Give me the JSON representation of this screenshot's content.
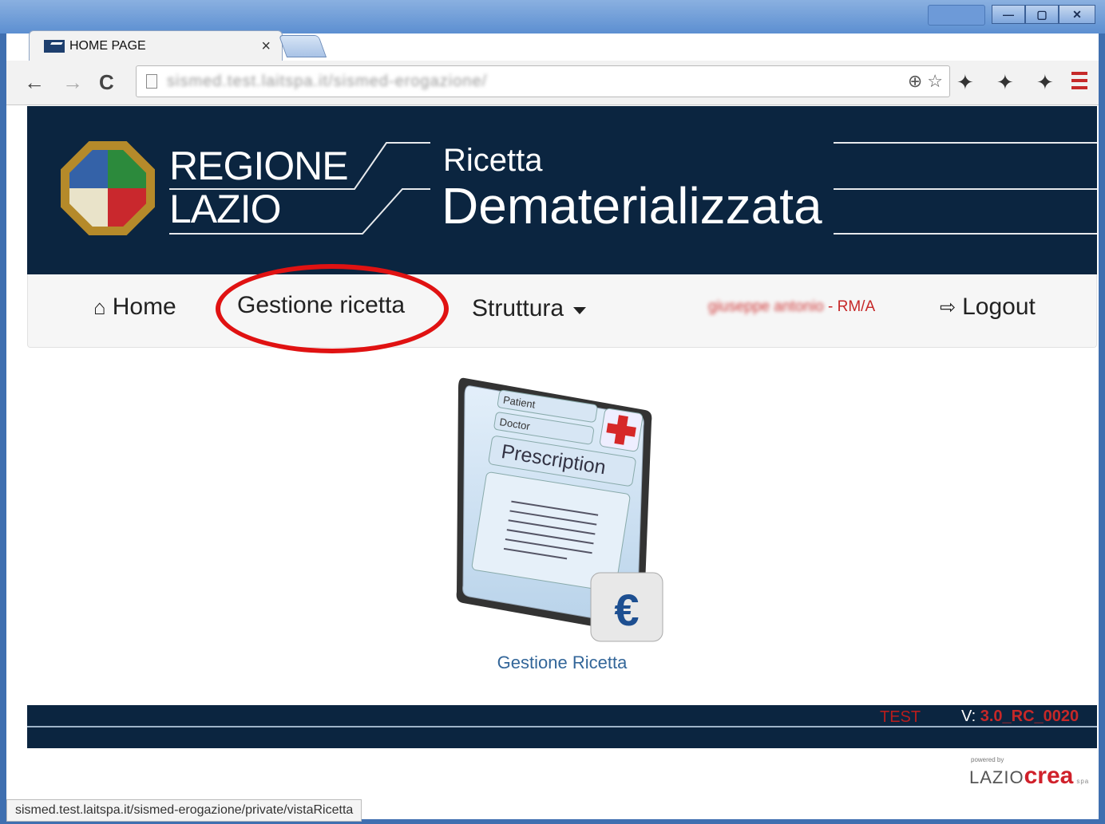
{
  "browser": {
    "tab_title": "HOME PAGE",
    "tab_close": "×",
    "url": "sismed.test.laitspa.it/sismed-erogazione/",
    "status_url": "sismed.test.laitspa.it/sismed-erogazione/private/vistaRicetta"
  },
  "header": {
    "region_line1": "REGIONE",
    "region_line2": "LAZIO",
    "app_line1": "Ricetta",
    "app_line2": "Dematerializzata"
  },
  "nav": {
    "home": "Home",
    "gestione": "Gestione ricetta",
    "struttura": "Struttura",
    "user_name": "giuseppe antonio",
    "user_suffix": "- RM/A",
    "logout": "Logout"
  },
  "tile": {
    "label": "Gestione Ricetta",
    "patient": "Patient",
    "doctor": "Doctor",
    "prescription": "Prescription",
    "euro": "€"
  },
  "footer": {
    "env": "TEST",
    "version_prefix": "V:",
    "version": "3.0_RC_0020"
  },
  "branding": {
    "powered": "powered by",
    "lazio": "LAZIO",
    "crea": "crea",
    "spa": "spa"
  },
  "colors": {
    "banner": "#0b2540",
    "highlight": "#e01212",
    "link": "#336699"
  }
}
